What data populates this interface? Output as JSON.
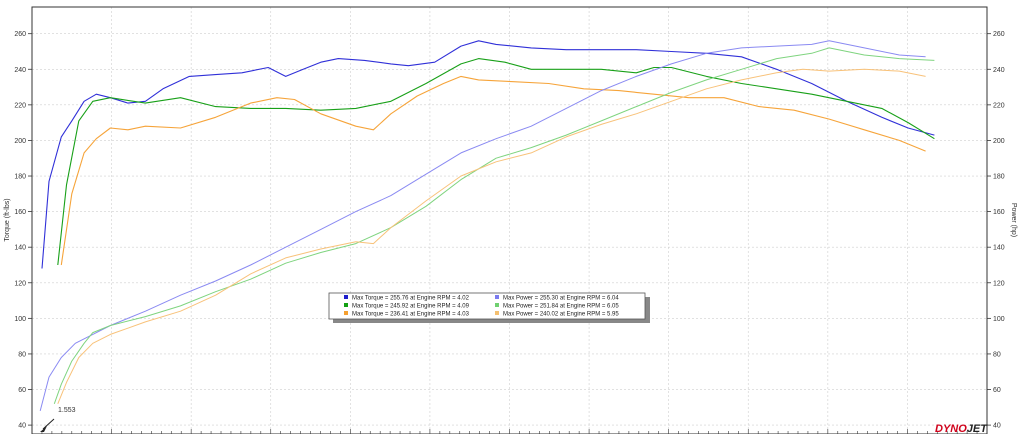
{
  "brand": {
    "part1": "DYNO",
    "part2": "JET",
    "color1": "#d0021b",
    "color2": "#222222"
  },
  "marker": {
    "label": "1.553"
  },
  "legend": [
    {
      "text": "Max Torque = 255.76 at Engine RPM = 4.02",
      "color": "#1f1fcc"
    },
    {
      "text": "Max Power = 255.30 at Engine RPM = 6.04",
      "color": "#7b7bf0"
    },
    {
      "text": "Max Torque = 245.92 at Engine RPM = 4.09",
      "color": "#12a012"
    },
    {
      "text": "Max Power = 251.84 at Engine RPM = 6.05",
      "color": "#70d070"
    },
    {
      "text": "Max Torque = 236.41 at Engine RPM = 4.03",
      "color": "#f5a030"
    },
    {
      "text": "Max Power = 240.02 at Engine RPM = 5.95",
      "color": "#f5c070"
    }
  ],
  "chart_data": {
    "type": "line",
    "title": "",
    "ylabel": "Torque (ft-lbs)",
    "y2label": "Power (hp)",
    "xlabel": "",
    "xlim": [
      1.553,
      7.0
    ],
    "ylim": [
      35,
      275
    ],
    "yticks": [
      40,
      60,
      80,
      100,
      120,
      140,
      160,
      180,
      200,
      220,
      240,
      260
    ],
    "grid": true,
    "series": [
      {
        "color": "#3030d8",
        "width": 1.1,
        "x": [
          1.61,
          1.65,
          1.72,
          1.78,
          1.85,
          1.92,
          2.0,
          2.1,
          2.2,
          2.3,
          2.45,
          2.6,
          2.75,
          2.9,
          3.0,
          3.1,
          3.2,
          3.3,
          3.45,
          3.6,
          3.7,
          3.85,
          4.0,
          4.1,
          4.2,
          4.4,
          4.6,
          4.8,
          5.0,
          5.2,
          5.4,
          5.6,
          5.8,
          6.0,
          6.2,
          6.4,
          6.55,
          6.7
        ],
        "y": [
          128,
          177,
          202,
          211,
          222,
          226,
          224,
          221,
          222,
          229,
          236,
          237,
          238,
          241,
          236,
          240,
          244,
          246,
          245,
          243,
          242,
          244,
          253,
          256,
          254,
          252,
          251,
          251,
          251,
          250,
          249,
          247,
          240,
          232,
          222,
          213,
          207,
          203
        ]
      },
      {
        "color": "#18a018",
        "width": 1.1,
        "x": [
          1.7,
          1.75,
          1.82,
          1.9,
          2.0,
          2.2,
          2.4,
          2.6,
          2.8,
          3.0,
          3.2,
          3.4,
          3.6,
          3.8,
          4.0,
          4.1,
          4.25,
          4.4,
          4.6,
          4.8,
          5.0,
          5.1,
          5.2,
          5.4,
          5.6,
          5.8,
          6.0,
          6.2,
          6.4,
          6.55,
          6.7
        ],
        "y": [
          130,
          175,
          211,
          222,
          224,
          221,
          224,
          219,
          218,
          218,
          217,
          218,
          222,
          232,
          243,
          246,
          244,
          240,
          240,
          240,
          238,
          241,
          241,
          236,
          232,
          229,
          226,
          222,
          218,
          210,
          201
        ]
      },
      {
        "color": "#f6a43a",
        "width": 1.1,
        "x": [
          1.72,
          1.78,
          1.85,
          1.92,
          2.0,
          2.1,
          2.2,
          2.4,
          2.6,
          2.8,
          2.95,
          3.05,
          3.2,
          3.4,
          3.5,
          3.6,
          3.75,
          3.9,
          4.0,
          4.1,
          4.3,
          4.5,
          4.7,
          4.9,
          5.1,
          5.3,
          5.5,
          5.7,
          5.9,
          6.1,
          6.3,
          6.5,
          6.65
        ],
        "y": [
          130,
          170,
          193,
          201,
          207,
          206,
          208,
          207,
          213,
          221,
          224,
          223,
          215,
          208,
          206,
          215,
          225,
          232,
          236,
          234,
          233,
          232,
          229,
          228,
          226,
          224,
          224,
          219,
          217,
          212,
          206,
          200,
          194
        ]
      },
      {
        "color": "#8a8af2",
        "width": 1.0,
        "x": [
          1.6,
          1.65,
          1.72,
          1.8,
          1.9,
          2.0,
          2.2,
          2.4,
          2.6,
          2.8,
          3.0,
          3.2,
          3.4,
          3.6,
          3.8,
          4.0,
          4.2,
          4.4,
          4.6,
          4.8,
          5.0,
          5.2,
          5.4,
          5.6,
          5.8,
          6.0,
          6.1,
          6.3,
          6.5,
          6.65
        ],
        "y": [
          48,
          67,
          78,
          86,
          91,
          96,
          104,
          113,
          121,
          130,
          140,
          150,
          160,
          169,
          181,
          193,
          201,
          208,
          218,
          228,
          236,
          243,
          249,
          252,
          253,
          254,
          256,
          252,
          248,
          247
        ]
      },
      {
        "color": "#7fd47f",
        "width": 1.0,
        "x": [
          1.68,
          1.72,
          1.78,
          1.85,
          1.9,
          2.0,
          2.2,
          2.4,
          2.6,
          2.8,
          3.0,
          3.2,
          3.4,
          3.6,
          3.8,
          4.0,
          4.2,
          4.4,
          4.6,
          4.8,
          5.0,
          5.2,
          5.4,
          5.6,
          5.8,
          6.0,
          6.1,
          6.3,
          6.5,
          6.7
        ],
        "y": [
          52,
          63,
          76,
          86,
          92,
          96,
          101,
          107,
          115,
          122,
          131,
          137,
          142,
          151,
          163,
          178,
          190,
          196,
          203,
          211,
          219,
          227,
          234,
          240,
          246,
          249,
          252,
          248,
          246,
          245
        ]
      },
      {
        "color": "#f8c27a",
        "width": 1.0,
        "x": [
          1.7,
          1.75,
          1.82,
          1.9,
          2.0,
          2.2,
          2.4,
          2.6,
          2.8,
          3.0,
          3.2,
          3.4,
          3.5,
          3.6,
          3.8,
          4.0,
          4.2,
          4.4,
          4.6,
          4.8,
          5.0,
          5.2,
          5.4,
          5.6,
          5.8,
          5.95,
          6.1,
          6.3,
          6.5,
          6.65
        ],
        "y": [
          52,
          64,
          78,
          86,
          91,
          98,
          104,
          113,
          125,
          134,
          139,
          143,
          142,
          151,
          166,
          180,
          188,
          193,
          202,
          209,
          215,
          222,
          229,
          234,
          238,
          240,
          239,
          240,
          239,
          236
        ]
      }
    ]
  }
}
